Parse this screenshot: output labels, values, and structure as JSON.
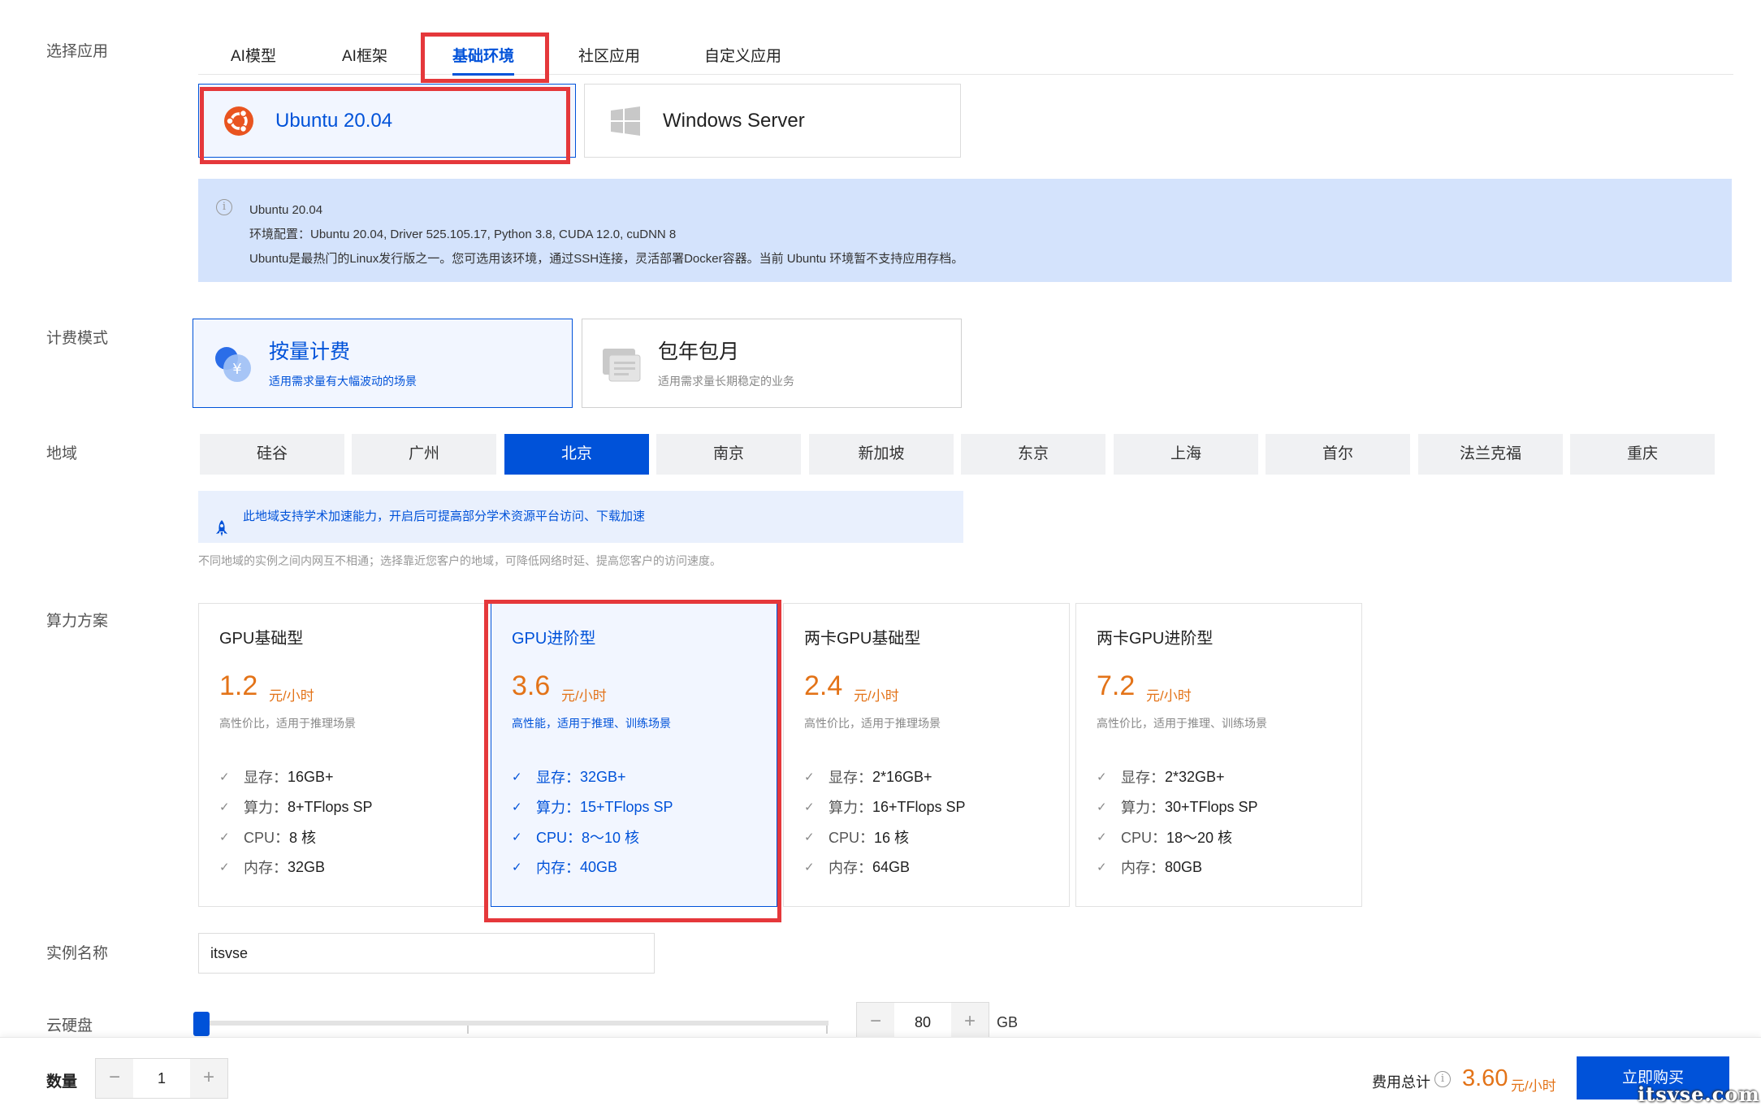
{
  "labels": {
    "select_app": "选择应用",
    "billing": "计费模式",
    "region": "地域",
    "compute": "算力方案",
    "instance_name": "实例名称",
    "disk": "云硬盘",
    "quantity": "数量"
  },
  "tabs": [
    {
      "label": "AI模型"
    },
    {
      "label": "AI框架"
    },
    {
      "label": "基础环境"
    },
    {
      "label": "社区应用"
    },
    {
      "label": "自定义应用"
    }
  ],
  "os": {
    "ubuntu": "Ubuntu 20.04",
    "windows": "Windows Server"
  },
  "info": {
    "line1": "Ubuntu 20.04",
    "line2": "环境配置：Ubuntu 20.04, Driver 525.105.17, Python 3.8, CUDA 12.0, cuDNN 8",
    "line3": "Ubuntu是最热门的Linux发行版之一。您可选用该环境，通过SSH连接，灵活部署Docker容器。当前 Ubuntu 环境暂不支持应用存档。"
  },
  "billing": {
    "payg_title": "按量计费",
    "payg_sub": "适用需求量有大幅波动的场景",
    "monthly_title": "包年包月",
    "monthly_sub": "适用需求量长期稳定的业务"
  },
  "regions": [
    "硅谷",
    "广州",
    "北京",
    "南京",
    "新加坡",
    "东京",
    "上海",
    "首尔",
    "法兰克福",
    "重庆"
  ],
  "accel_notice": "此地域支持学术加速能力，开启后可提高部分学术资源平台访问、下载加速",
  "region_hint": "不同地域的实例之间内网互不相通；选择靠近您客户的地域，可降低网络时延、提高您客户的访问速度。",
  "gpu_plans": [
    {
      "title": "GPU基础型",
      "price": "1.2",
      "unit": "元/小时",
      "desc": "高性价比，适用于推理场景",
      "specs": [
        {
          "k": "显存：",
          "v": "16GB+"
        },
        {
          "k": "算力：",
          "v": "8+TFlops SP"
        },
        {
          "k": "CPU：",
          "v": "8 核"
        },
        {
          "k": "内存：",
          "v": "32GB"
        }
      ]
    },
    {
      "title": "GPU进阶型",
      "price": "3.6",
      "unit": "元/小时",
      "desc": "高性能，适用于推理、训练场景",
      "specs": [
        {
          "k": "显存：",
          "v": "32GB+"
        },
        {
          "k": "算力：",
          "v": "15+TFlops SP"
        },
        {
          "k": "CPU：",
          "v": "8～10 核"
        },
        {
          "k": "内存：",
          "v": "40GB"
        }
      ]
    },
    {
      "title": "两卡GPU基础型",
      "price": "2.4",
      "unit": "元/小时",
      "desc": "高性价比，适用于推理场景",
      "specs": [
        {
          "k": "显存：",
          "v": "2*16GB+"
        },
        {
          "k": "算力：",
          "v": "16+TFlops SP"
        },
        {
          "k": "CPU：",
          "v": "16 核"
        },
        {
          "k": "内存：",
          "v": "64GB"
        }
      ]
    },
    {
      "title": "两卡GPU进阶型",
      "price": "7.2",
      "unit": "元/小时",
      "desc": "高性价比，适用于推理、训练场景",
      "specs": [
        {
          "k": "显存：",
          "v": "2*32GB+"
        },
        {
          "k": "算力：",
          "v": "30+TFlops SP"
        },
        {
          "k": "CPU：",
          "v": "18～20 核"
        },
        {
          "k": "内存：",
          "v": "80GB"
        }
      ]
    }
  ],
  "instance_name_value": "itsvse",
  "disk": {
    "value": "80",
    "unit": "GB",
    "minus": "−",
    "plus": "+"
  },
  "quantity": {
    "value": "1",
    "minus": "−",
    "plus": "+"
  },
  "total": {
    "label": "费用总计",
    "info": "i",
    "price": "3.60",
    "unit": "元/小时"
  },
  "buy_label": "立即购买",
  "watermark": "itsvse.com",
  "colors": {
    "accent": "#0052d9",
    "price": "#e37318",
    "highlight": "#e5383b"
  }
}
